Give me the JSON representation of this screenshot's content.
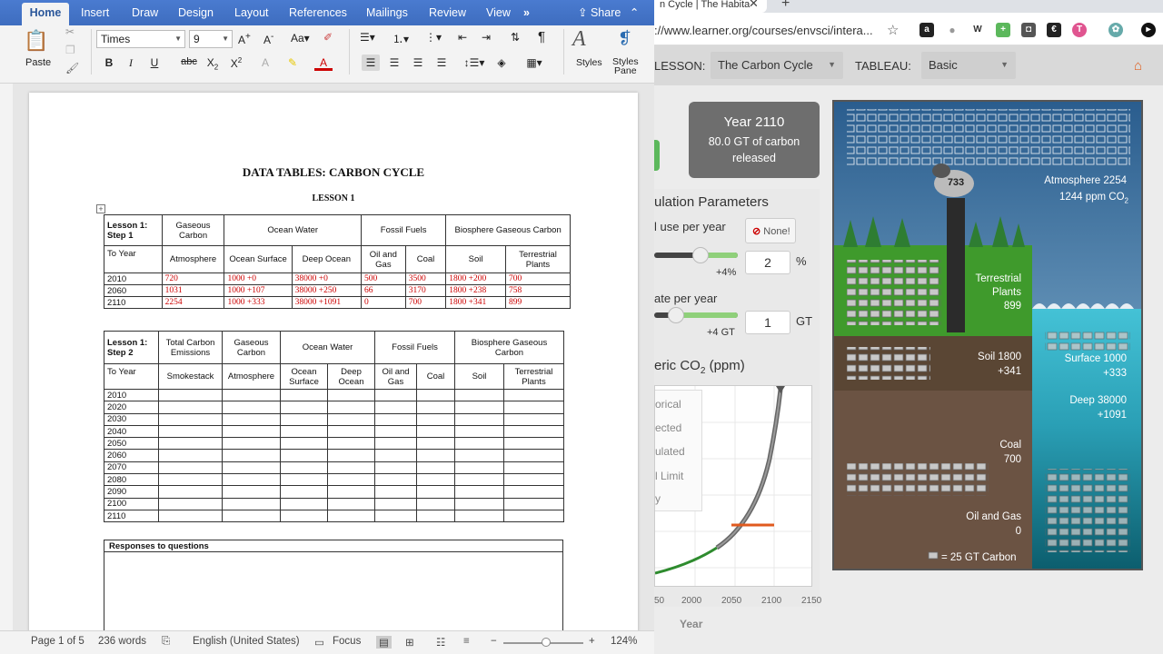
{
  "word": {
    "ribbon_tabs": [
      "Home",
      "Insert",
      "Draw",
      "Design",
      "Layout",
      "References",
      "Mailings",
      "Review",
      "View"
    ],
    "more_tabs": "»",
    "share": "Share",
    "font_name": "Times",
    "font_size": "9",
    "paste": "Paste",
    "styles": "Styles",
    "styles_pane": "Styles\nPane",
    "doc_title": "DATA TABLES: CARBON CYCLE",
    "doc_subtitle": "LESSON 1",
    "table1": {
      "step": "Lesson 1:\nStep 1",
      "groups": [
        "Gaseous Carbon",
        "Ocean Water",
        "Fossil Fuels",
        "Biosphere Gaseous Carbon"
      ],
      "to_year": "To Year",
      "cols": [
        "Atmosphere",
        "Ocean Surface",
        "Deep Ocean",
        "Oil and Gas",
        "Coal",
        "Soil",
        "Terrestrial Plants"
      ],
      "rows": [
        [
          "2010",
          "720",
          "1000 +0",
          "38000 +0",
          "500",
          "3500",
          "1800 +200",
          "700"
        ],
        [
          "2060",
          "1031",
          "1000 +107",
          "38000 +250",
          "66",
          "3170",
          "1800 +238",
          "758"
        ],
        [
          "2110",
          "2254",
          "1000 +333",
          "38000 +1091",
          "0",
          "700",
          "1800 +341",
          "899"
        ]
      ]
    },
    "table2": {
      "step": "Lesson 1:\nStep 2",
      "groups": [
        "Total Carbon Emissions",
        "Gaseous Carbon",
        "Ocean Water",
        "Fossil Fuels",
        "Biosphere Gaseous Carbon"
      ],
      "to_year": "To Year",
      "cols": [
        "Smokestack",
        "Atmosphere",
        "Ocean Surface",
        "Deep Ocean",
        "Oil and Gas",
        "Coal",
        "Soil",
        "Terrestrial Plants"
      ],
      "years": [
        "2010",
        "2020",
        "2030",
        "2040",
        "2050",
        "2060",
        "2070",
        "2080",
        "2090",
        "2100",
        "2110"
      ]
    },
    "responses_header": "Responses to questions",
    "status": {
      "page": "Page 1 of 5",
      "words": "236 words",
      "language": "English (United States)",
      "focus": "Focus",
      "zoom": "124%"
    }
  },
  "browser": {
    "tab_title": "n Cycle | The Habita",
    "url": "://www.learner.org/courses/envsci/intera...",
    "lesson_label": "LESSON:",
    "lesson_value": "The Carbon Cycle",
    "tableau_label": "TABLEAU:",
    "tableau_value": "Basic",
    "year_box": {
      "year": "Year 2110",
      "line1": "80.0 GT of carbon",
      "line2": "released"
    },
    "sim_title": "ulation Parameters",
    "param1": {
      "label": "l use per year",
      "button": "None!",
      "value": "2",
      "unit": "%",
      "tick": "+4%",
      "level": 0.55
    },
    "param2": {
      "label": "ate per year",
      "value": "1",
      "unit": "GT",
      "tick": "+4 GT",
      "level": 0.26
    },
    "co2_title_a": "eric CO",
    "co2_title_sub": "2",
    "co2_title_b": " (ppm)",
    "legend": [
      "orical",
      "ected",
      "ulated",
      "l Limit",
      "y"
    ],
    "x_ticks": [
      "50",
      "2000",
      "2050",
      "2100",
      "2150"
    ],
    "x_label": "Year",
    "diagram": {
      "smoke": "733",
      "atmosphere": "Atmosphere 2254",
      "atmosphere_ppm_a": "1244 ppm CO",
      "atmosphere_ppm_sub": "2",
      "plants": [
        "Terrestrial",
        "Plants",
        "899"
      ],
      "soil": [
        "Soil 1800",
        "+341"
      ],
      "surface": [
        "Surface 1000",
        "+333"
      ],
      "deep": [
        "Deep 38000",
        "+1091"
      ],
      "coal": [
        "Coal",
        "700"
      ],
      "oil": [
        "Oil and Gas",
        "0"
      ],
      "key": "= 25 GT Carbon",
      "colors": {
        "sky": "#2d6f9e",
        "grass": "#3a9a2a",
        "soil": "#5e4a36",
        "coal_layer": "#6b5442",
        "ocean": "#3fb6c8",
        "deep": "#0f6b7a"
      }
    }
  }
}
